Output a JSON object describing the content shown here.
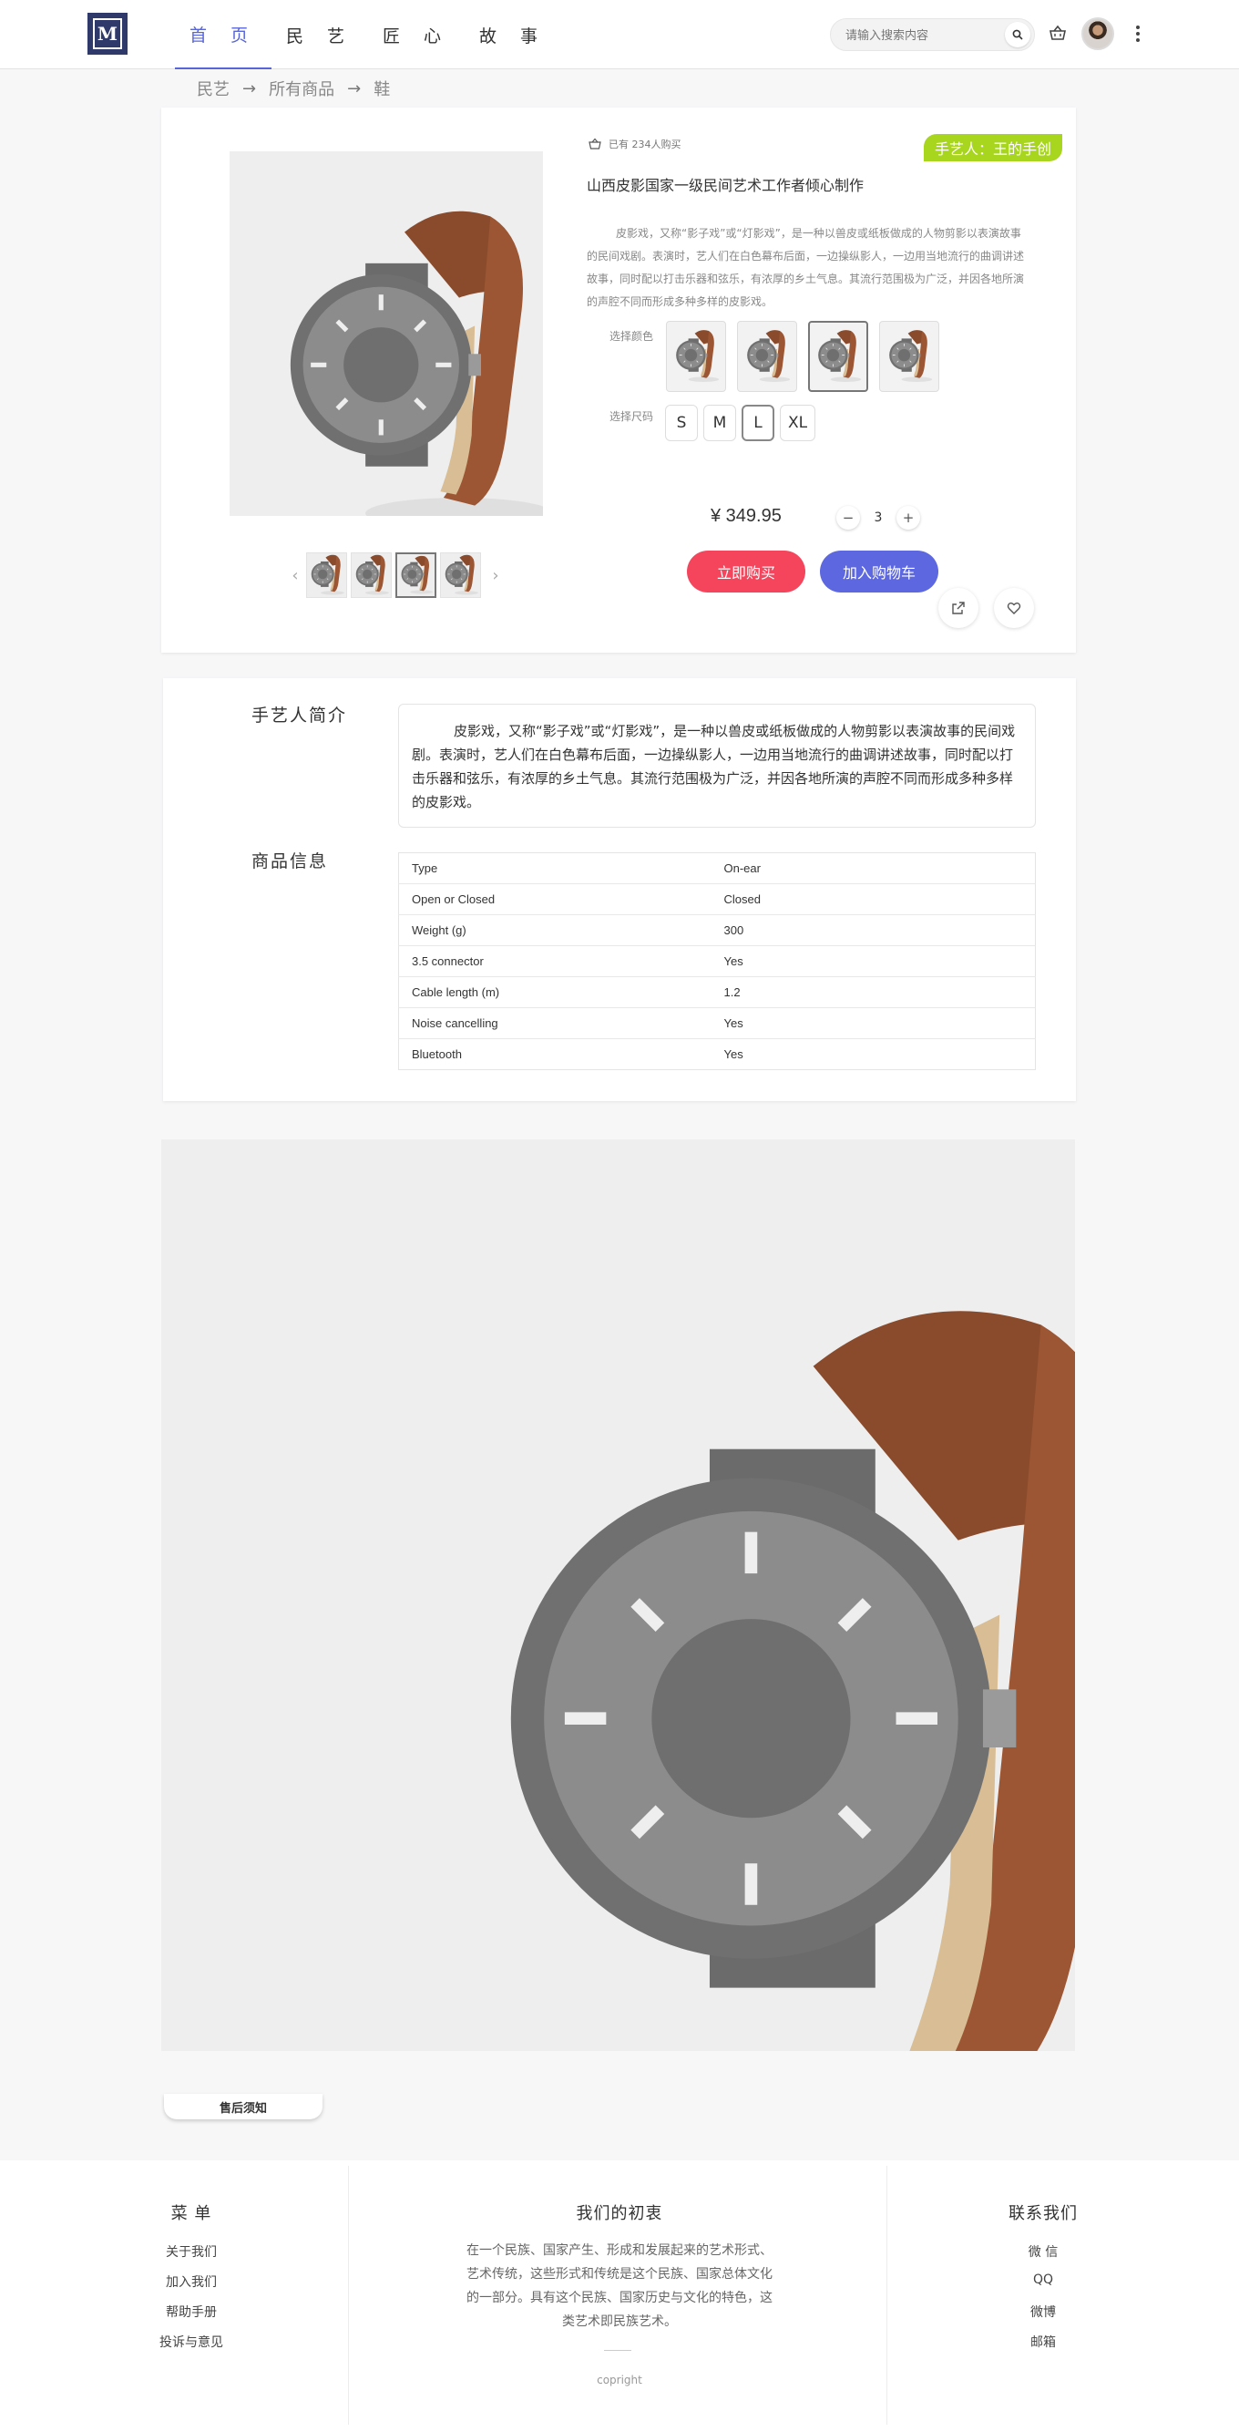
{
  "header": {
    "logo_letter": "M",
    "nav": [
      "首 页",
      "民 艺",
      "匠 心",
      "故 事"
    ],
    "search_placeholder": "请输入搜索内容"
  },
  "breadcrumb": [
    "民艺",
    "所有商品",
    "鞋"
  ],
  "product": {
    "buyers": "已有 234人购买",
    "artisan_tag": "手艺人：王的手创",
    "title": "山西皮影国家一级民间艺术工作者倾心制作",
    "description": "皮影戏，又称“影子戏”或“灯影戏”，是一种以兽皮或纸板做成的人物剪影以表演故事的民间戏剧。表演时，艺人们在白色幕布后面，一边操纵影人，一边用当地流行的曲调讲述故事，同时配以打击乐器和弦乐，有浓厚的乡土气息。其流行范围极为广泛，并因各地所演的声腔不同而形成多种多样的皮影戏。",
    "color_label": "选择颜色",
    "size_label": "选择尺码",
    "sizes": [
      "S",
      "M",
      "L",
      "XL"
    ],
    "selected_size": "L",
    "price": "¥ 349.95",
    "quantity": "3",
    "buy_now": "立即购买",
    "add_to_cart": "加入购物车"
  },
  "info": {
    "artisan_title": "手艺人简介",
    "artisan_intro": "皮影戏，又称“影子戏”或“灯影戏”，是一种以兽皮或纸板做成的人物剪影以表演故事的民间戏剧。表演时，艺人们在白色幕布后面，一边操纵影人，一边用当地流行的曲调讲述故事，同时配以打击乐器和弦乐，有浓厚的乡土气息。其流行范围极为广泛，并因各地所演的声腔不同而形成多种多样的皮影戏。",
    "goods_title": "商品信息",
    "specs": [
      {
        "k": "Type",
        "v": "On-ear"
      },
      {
        "k": "Open or Closed",
        "v": "Closed"
      },
      {
        "k": "Weight (g)",
        "v": "300"
      },
      {
        "k": "3.5 connector",
        "v": "Yes"
      },
      {
        "k": "Cable length (m)",
        "v": "1.2"
      },
      {
        "k": "Noise cancelling",
        "v": "Yes"
      },
      {
        "k": "Bluetooth",
        "v": "Yes"
      }
    ]
  },
  "after_sale": "售后须知",
  "footer": {
    "menu_title": "菜 单",
    "menu_links": [
      "关于我们",
      "加入我们",
      "帮助手册",
      "投诉与意见"
    ],
    "mission_title": "我们的初衷",
    "mission_text": "在一个民族、国家产生、形成和发展起来的艺术形式、艺术传统，这些形式和传统是这个民族、国家总体文化的一部分。具有这个民族、国家历史与文化的特色，这类艺术即民族艺术。",
    "copyright": "copright",
    "contact_title": "联系我们",
    "contact_links": [
      "微 信",
      "QQ",
      "微博",
      "邮箱"
    ]
  },
  "colors": {
    "accent": "#5865d8",
    "buy_button": "#f4455c",
    "cart_button": "#5c67e0",
    "artisan_tag": "#a8d61e"
  }
}
